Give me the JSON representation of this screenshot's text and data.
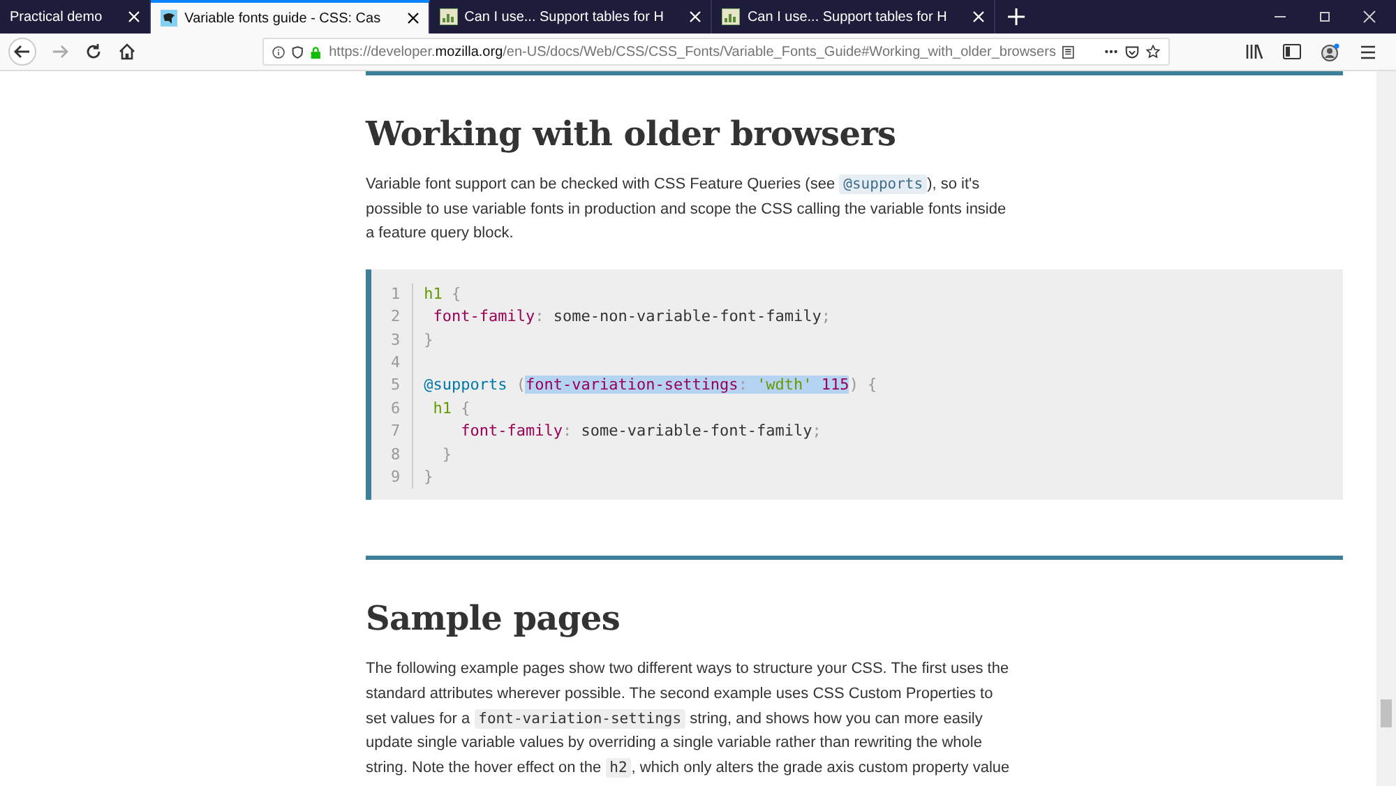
{
  "tabs": [
    {
      "title": "Practical demo",
      "selected": false
    },
    {
      "title": "Variable fonts guide - CSS: Cas",
      "selected": true
    },
    {
      "title": "Can I use... Support tables for H",
      "selected": false
    },
    {
      "title": "Can I use... Support tables for H",
      "selected": false
    }
  ],
  "address_bar": {
    "prefix": "https://developer.",
    "domain": "mozilla.org",
    "path": "/en-US/docs/Web/CSS/CSS_Fonts/Variable_Fonts_Guide#Working_with_older_browsers"
  },
  "sections": [
    {
      "heading": "Working with older browsers",
      "paragraph": [
        {
          "kind": "text",
          "text": "Variable font support can be checked with CSS Feature Queries (see "
        },
        {
          "kind": "code",
          "text": "@supports"
        },
        {
          "kind": "text",
          "text": "), so it's possible to use variable fonts in production and scope the CSS calling the variable fonts inside a feature query block."
        }
      ],
      "code": [
        {
          "number": "1",
          "tokens": [
            {
              "kind": "tag",
              "text": "h1",
              "selected": false
            },
            {
              "kind": "punct",
              "text": " {",
              "selected": false
            }
          ]
        },
        {
          "number": "2",
          "tokens": [
            {
              "kind": "prop",
              "text": " font-family",
              "selected": false
            },
            {
              "kind": "punct",
              "text": ": ",
              "selected": false
            },
            {
              "kind": "plain",
              "text": "some-non-variable-font-family",
              "selected": false
            },
            {
              "kind": "punct",
              "text": ";",
              "selected": false
            }
          ]
        },
        {
          "number": "3",
          "tokens": [
            {
              "kind": "punct",
              "text": "}",
              "selected": false
            }
          ]
        },
        {
          "number": "4"
        },
        {
          "number": "5",
          "tokens": [
            {
              "kind": "atrule",
              "text": "@supports",
              "selected": false
            },
            {
              "kind": "punct",
              "text": " (",
              "selected": false
            },
            {
              "kind": "prop",
              "text": "font-variation-settings",
              "selected": true
            },
            {
              "kind": "punct",
              "text": ": ",
              "selected": true
            },
            {
              "kind": "string",
              "text": "'wdth'",
              "selected": true
            },
            {
              "kind": "number",
              "text": " 115",
              "selected": true
            },
            {
              "kind": "punct",
              "text": ") {",
              "selected": false
            }
          ]
        },
        {
          "number": "6",
          "tokens": [
            {
              "kind": "tag",
              "text": " h1",
              "selected": false
            },
            {
              "kind": "punct",
              "text": " {",
              "selected": false
            }
          ]
        },
        {
          "number": "7",
          "tokens": [
            {
              "kind": "prop",
              "text": "    font-family",
              "selected": false
            },
            {
              "kind": "punct",
              "text": ": ",
              "selected": false
            },
            {
              "kind": "plain",
              "text": "some-variable-font-family",
              "selected": false
            },
            {
              "kind": "punct",
              "text": ";",
              "selected": false
            }
          ]
        },
        {
          "number": "8",
          "tokens": [
            {
              "kind": "punct",
              "text": "  }",
              "selected": false
            }
          ]
        },
        {
          "number": "9",
          "tokens": [
            {
              "kind": "punct",
              "text": "}",
              "selected": false
            }
          ]
        }
      ]
    },
    {
      "heading": "Sample pages",
      "paragraph": [
        {
          "kind": "text",
          "text": "The following example pages show two different ways to structure your CSS. The first uses the standard attributes wherever possible. The second example uses CSS Custom Properties to set values for a "
        },
        {
          "kind": "code",
          "text": "font-variation-settings"
        },
        {
          "kind": "text",
          "text": " string, and shows how you can more easily update single variable values by overriding a single variable rather than rewriting the whole string. Note the hover effect on the "
        },
        {
          "kind": "code",
          "text": "h2"
        },
        {
          "kind": "text",
          "text": ", which only alters the grade axis custom property value"
        }
      ]
    }
  ]
}
